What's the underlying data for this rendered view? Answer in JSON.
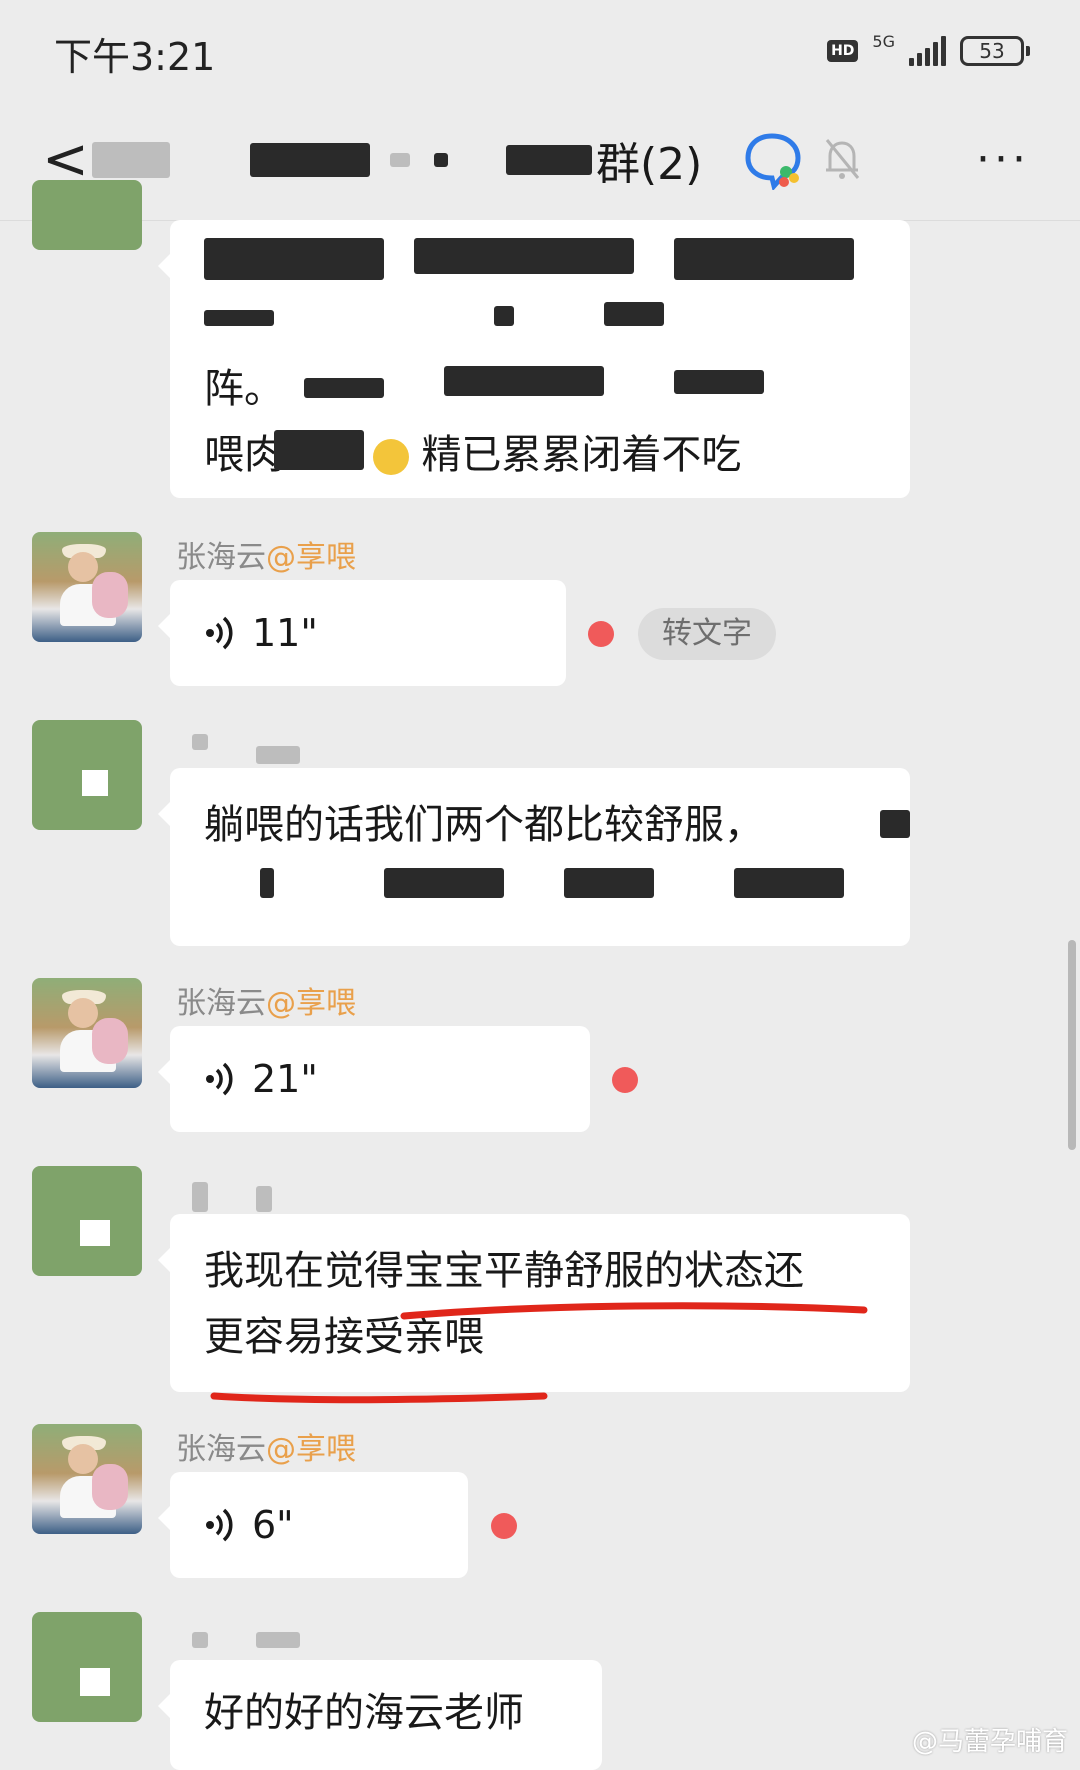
{
  "status_bar": {
    "time": "下午3:21",
    "hd": "HD",
    "network": "5G",
    "battery": "53"
  },
  "header": {
    "title_visible": "群(2)",
    "more": "···"
  },
  "messages": [
    {
      "type": "text",
      "visible_lines": [
        "阵。",
        "喂肉",
        "精已累累闭着不吃"
      ]
    },
    {
      "type": "voice",
      "sender": "张海云",
      "tag": "@享喂",
      "duration": "11\"",
      "to_text": "转文字",
      "unread": true
    },
    {
      "type": "text",
      "lines": [
        "躺喂的话我们两个都比较舒服，"
      ]
    },
    {
      "type": "voice",
      "sender": "张海云",
      "tag": "@享喂",
      "duration": "21\"",
      "unread": true
    },
    {
      "type": "text",
      "lines": [
        "我现在觉得宝宝平静舒服的状态还",
        "更容易接受亲喂"
      ],
      "highlighted": true
    },
    {
      "type": "voice",
      "sender": "张海云",
      "tag": "@享喂",
      "duration": "6\"",
      "unread": true
    },
    {
      "type": "text",
      "lines": [
        "好的好的海云老师"
      ]
    }
  ],
  "watermark": "@马蕾孕哺育",
  "colors": {
    "background": "#ececec",
    "bubble": "#ffffff",
    "unread_dot": "#f05a5a",
    "tag": "#e9a04b",
    "highlight": "#e0261a"
  }
}
